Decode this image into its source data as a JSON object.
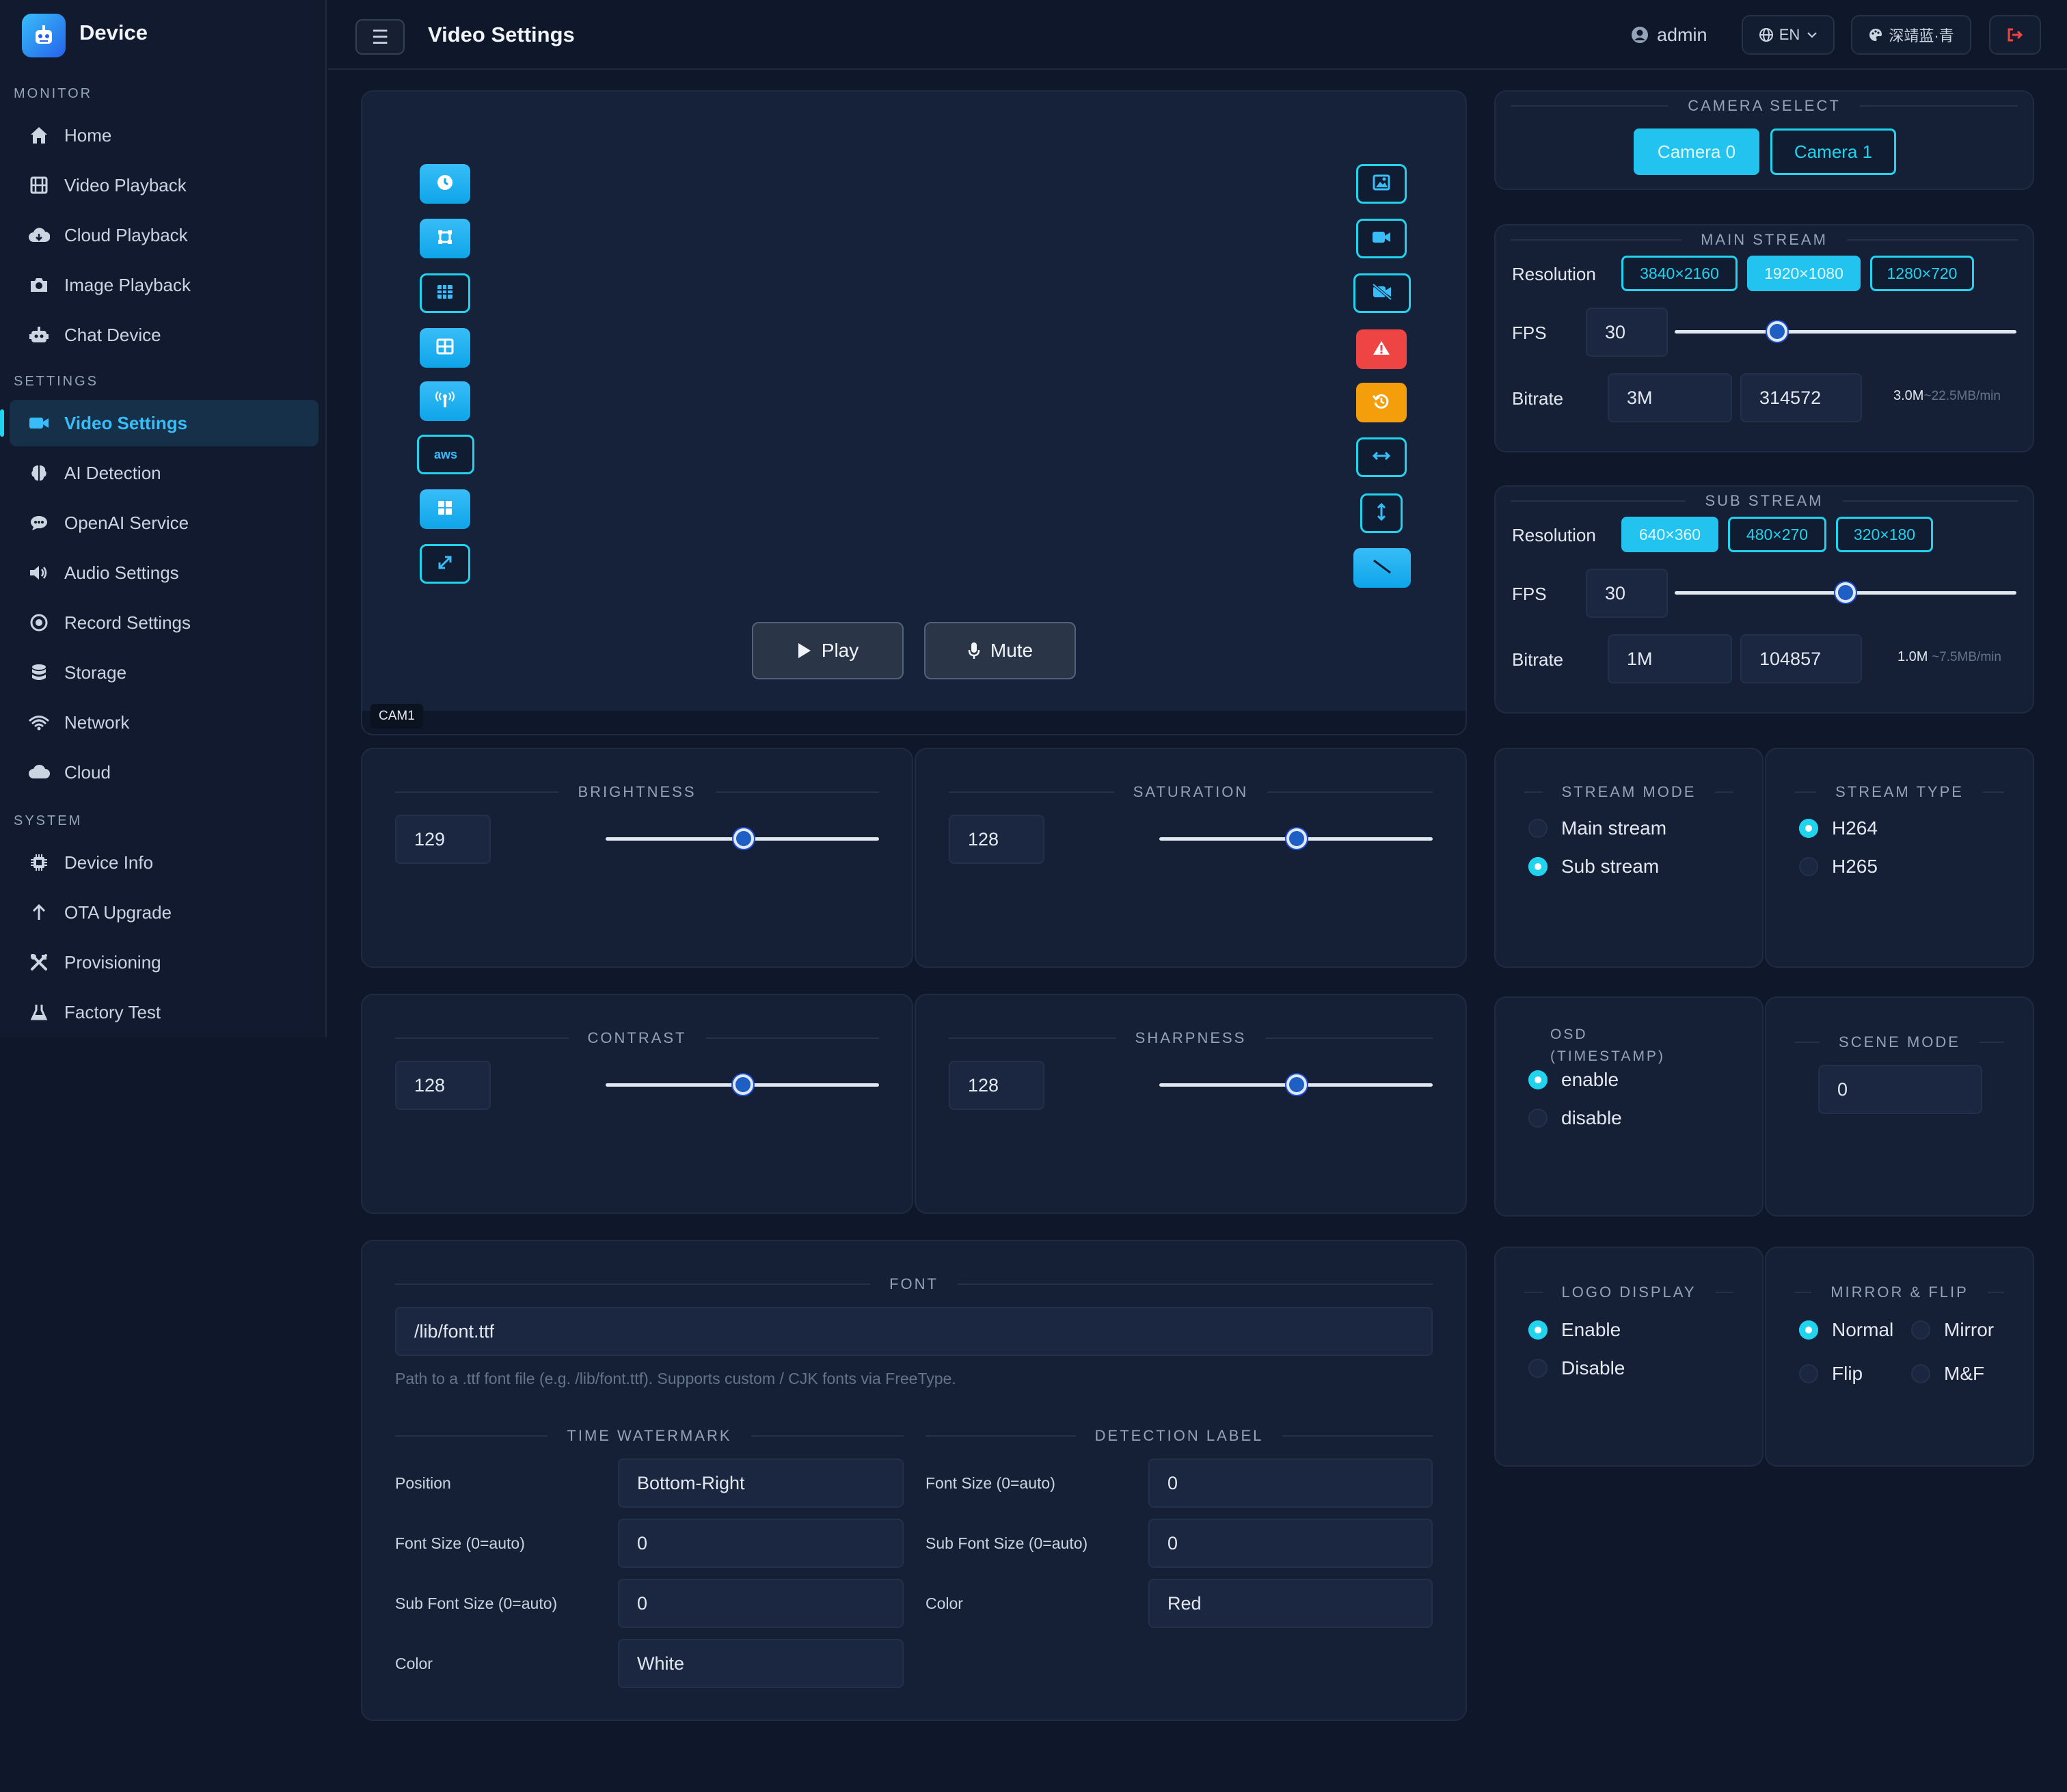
{
  "brand": "Device",
  "header": {
    "title": "Video Settings",
    "user": "admin",
    "lang": "EN",
    "theme": "深靖蓝·青"
  },
  "sidebar": {
    "monitor": "MONITOR",
    "settings": "SETTINGS",
    "system": "SYSTEM",
    "items": [
      "Home",
      "Video Playback",
      "Cloud Playback",
      "Image Playback",
      "Chat Device",
      "Video Settings",
      "AI Detection",
      "OpenAI Service",
      "Audio Settings",
      "Record Settings",
      "Storage",
      "Network",
      "Cloud",
      "Device Info",
      "OTA Upgrade",
      "Provisioning",
      "Factory Test"
    ]
  },
  "preview": {
    "cam_label": "CAM1",
    "play": "Play",
    "mute": "Mute"
  },
  "camera_select": {
    "legend": "CAMERA SELECT",
    "options": [
      "Camera 0",
      "Camera 1"
    ],
    "selected": "Camera 0"
  },
  "main_stream": {
    "legend": "MAIN STREAM",
    "resolution_label": "Resolution",
    "resolutions": [
      "3840×2160",
      "1920×1080",
      "1280×720"
    ],
    "selected": "1920×1080",
    "fps_label": "FPS",
    "fps": "30",
    "fps_level": 0.3,
    "bitrate_label": "Bitrate",
    "bitrate": "3M",
    "bitrate_raw": "314572",
    "bitrate_info": "3.0M",
    "bitrate_rate": "~22.5MB/min"
  },
  "sub_stream": {
    "legend": "SUB STREAM",
    "resolution_label": "Resolution",
    "resolutions": [
      "640×360",
      "480×270",
      "320×180"
    ],
    "selected": "640×360",
    "fps_label": "FPS",
    "fps": "30",
    "fps_level": 0.5,
    "bitrate_label": "Bitrate",
    "bitrate": "1M",
    "bitrate_raw": "104857",
    "bitrate_info": "1.0M",
    "bitrate_rate": "~7.5MB/min"
  },
  "image": {
    "brightness": {
      "legend": "BRIGHTNESS",
      "value": "129",
      "level": 0.506
    },
    "saturation": {
      "legend": "SATURATION",
      "value": "128",
      "level": 0.502
    },
    "contrast": {
      "legend": "CONTRAST",
      "value": "128",
      "level": 0.502
    },
    "sharpness": {
      "legend": "SHARPNESS",
      "value": "128",
      "level": 0.502
    }
  },
  "stream_mode": {
    "legend": "STREAM MODE",
    "options": [
      "Main stream",
      "Sub stream"
    ],
    "selected": "Sub stream"
  },
  "stream_type": {
    "legend": "STREAM TYPE",
    "options": [
      "H264",
      "H265"
    ],
    "selected": "H264"
  },
  "osd": {
    "legend_line1": "OSD",
    "legend_line2": "(TIMESTAMP)",
    "options": [
      "enable",
      "disable"
    ],
    "selected": "enable"
  },
  "scene_mode": {
    "legend": "SCENE MODE",
    "value": "0"
  },
  "logo_display": {
    "legend": "LOGO DISPLAY",
    "options": [
      "Enable",
      "Disable"
    ],
    "selected": "Enable"
  },
  "mirror_flip": {
    "legend": "MIRROR & FLIP",
    "options": [
      "Normal",
      "Mirror",
      "Flip",
      "M&F"
    ],
    "selected": "Normal"
  },
  "font": {
    "legend": "FONT",
    "path": "/lib/font.ttf",
    "hint": "Path to a .ttf font file (e.g. /lib/font.ttf). Supports custom / CJK fonts via FreeType."
  },
  "time_watermark": {
    "legend": "TIME WATERMARK",
    "position_label": "Position",
    "position": "Bottom-Right",
    "font_size_label": "Font Size (0=auto)",
    "font_size": "0",
    "sub_font_size_label": "Sub Font Size (0=auto)",
    "sub_font_size": "0",
    "color_label": "Color",
    "color": "White"
  },
  "detection_label": {
    "legend": "DETECTION LABEL",
    "font_size_label": "Font Size (0=auto)",
    "font_size": "0",
    "sub_font_size_label": "Sub Font Size (0=auto)",
    "sub_font_size": "0",
    "color_label": "Color",
    "color": "Red"
  },
  "colors": {
    "accent": "#22d3ee",
    "danger": "#ef4444",
    "warning": "#f59e0b",
    "background": "#0f172a"
  }
}
